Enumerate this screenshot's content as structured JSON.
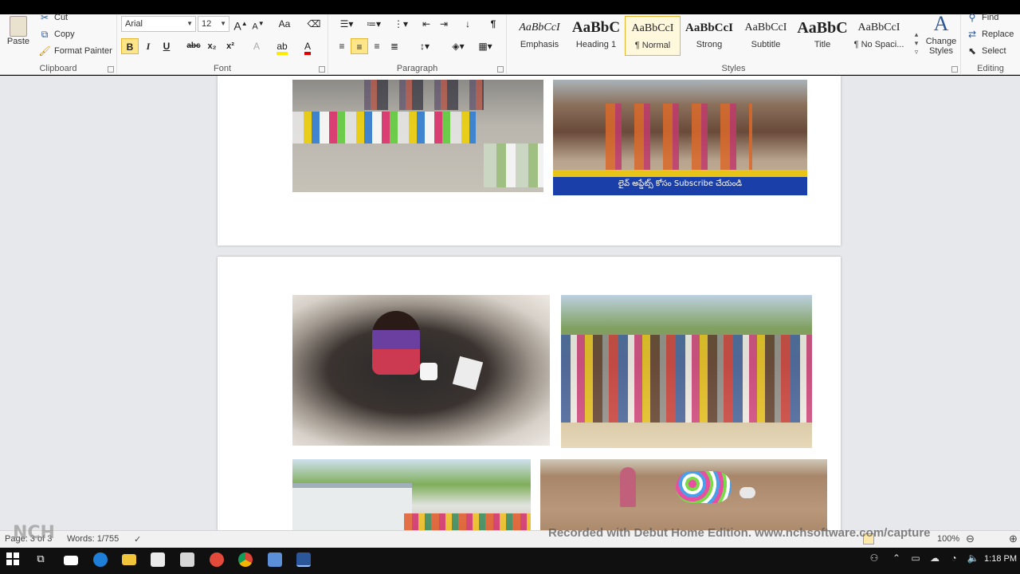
{
  "ribbon": {
    "clipboard": {
      "label": "Clipboard",
      "paste": "Paste",
      "cut": "Cut",
      "copy": "Copy",
      "format_painter": "Format Painter"
    },
    "font": {
      "label": "Font",
      "font_name": "Arial",
      "font_size": "12",
      "bold": "B",
      "italic": "I",
      "underline": "U",
      "strike": "abc",
      "subscript": "x₂",
      "superscript": "x²",
      "grow": "A",
      "shrink": "A",
      "change_case": "Aa"
    },
    "paragraph": {
      "label": "Paragraph",
      "pilcrow": "¶"
    },
    "styles": {
      "label": "Styles",
      "items": [
        {
          "sample": "AaBbCcI",
          "name": "Emphasis"
        },
        {
          "sample": "AaBbC",
          "name": "Heading 1"
        },
        {
          "sample": "AaBbCcI",
          "name": "¶ Normal"
        },
        {
          "sample": "AaBbCcI",
          "name": "Strong"
        },
        {
          "sample": "AaBbCcI",
          "name": "Subtitle"
        },
        {
          "sample": "AaBbC",
          "name": "Title"
        },
        {
          "sample": "AaBbCcI",
          "name": "¶ No Spaci..."
        }
      ],
      "change_styles": "Change Styles"
    },
    "editing": {
      "label": "Editing",
      "find": "Find",
      "replace": "Replace",
      "select": "Select"
    }
  },
  "document": {
    "photo_caption_banner": "లైవ్ అప్డేట్స్ కోసం Subscribe చేయండి"
  },
  "statusbar": {
    "page": "Page: 3 of 3",
    "words": "Words: 1/755",
    "zoom": "100%"
  },
  "watermark": "Recorded with Debut Home Edition. www.nchsoftware.com/capture",
  "nch_logo": "NCH",
  "taskbar": {
    "clock": "1:18 PM"
  },
  "colors": {
    "accent": "#2b579a",
    "selected_style": "#e5b531"
  }
}
